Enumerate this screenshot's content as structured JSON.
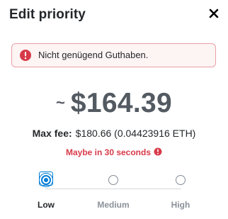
{
  "dialog": {
    "title": "Edit priority",
    "close_icon": "close-icon"
  },
  "alert": {
    "icon": "error-icon",
    "message": "Nicht genügend Guthaben.",
    "color": "#d73a49"
  },
  "fee": {
    "approx_symbol": "~",
    "amount": "$164.39",
    "max_fee_label": "Max fee:",
    "max_fee_value": "$180.66 (0.04423916 ETH)",
    "timing": "Maybe in 30 seconds",
    "timing_icon": "info-icon",
    "timing_color": "#d73a49"
  },
  "priority": {
    "selected": "Low",
    "options": [
      {
        "label": "Low",
        "selected": true
      },
      {
        "label": "Medium",
        "selected": false
      },
      {
        "label": "High",
        "selected": false
      }
    ],
    "accent": "#037dd6"
  }
}
